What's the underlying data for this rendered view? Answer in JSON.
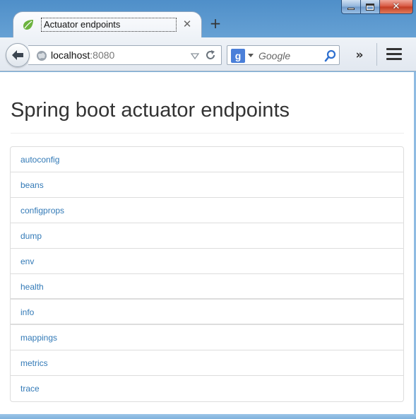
{
  "window": {
    "caption_buttons": [
      "minimize",
      "maximize",
      "close"
    ]
  },
  "tab": {
    "title": "Actuator endpoints",
    "close_label": "✕",
    "new_tab_label": "+"
  },
  "toolbar": {
    "url_host": "localhost",
    "url_port": ":8080",
    "search_engine_letter": "g",
    "search_placeholder": "Google",
    "overflow_label": "»"
  },
  "page": {
    "title": "Spring boot actuator endpoints",
    "endpoints": [
      "autoconfig",
      "beans",
      "configprops",
      "dump",
      "env",
      "health",
      "info",
      "mappings",
      "metrics",
      "trace"
    ]
  },
  "colors": {
    "link": "#337ab7",
    "title": "#333333",
    "border": "#dddddd",
    "favicon": "#6db33f"
  },
  "icons": {
    "tab_favicon": "spring-leaf-icon",
    "back": "back-arrow-icon",
    "url": "globe-icon",
    "reload": "reload-icon",
    "search": "magnifier-icon",
    "menu": "hamburger-menu-icon"
  }
}
